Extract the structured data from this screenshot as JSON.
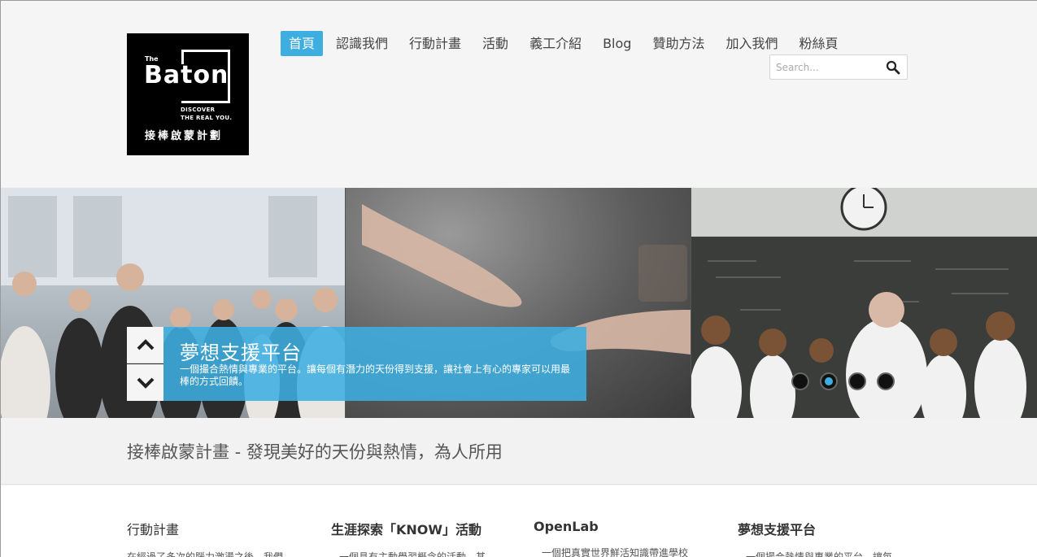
{
  "logo": {
    "the": "The",
    "word": "Baton",
    "sub1": "DISCOVER",
    "sub2": "THE REAL YOU.",
    "zh": "接棒啟蒙計劃"
  },
  "nav": {
    "items": [
      {
        "label": "首頁",
        "active": true
      },
      {
        "label": "認識我們"
      },
      {
        "label": "行動計畫"
      },
      {
        "label": "活動"
      },
      {
        "label": "義工介紹"
      },
      {
        "label": "Blog"
      },
      {
        "label": "贊助方法"
      },
      {
        "label": "加入我們"
      },
      {
        "label": "粉絲頁"
      }
    ]
  },
  "search": {
    "placeholder": "Search..."
  },
  "slider": {
    "caption_title": "夢想支援平台",
    "caption_text": "一個撮合熱情與專業的平台。讓每個有潛力的天份得到支援，讓社會上有心的專家可以用最棒的方式回饋。",
    "dots": 4,
    "active_dot": 2
  },
  "tagline": "接棒啟蒙計畫 - 發現美好的天份與熱情，為人所用",
  "columns": [
    {
      "title": "行動計畫",
      "text": "在經過了多次的腦力激盪之後，我們"
    },
    {
      "title": "生涯探索「KNOW」活動",
      "text": "一個具有主動學習概念的活動。其"
    },
    {
      "title": "OpenLab",
      "text": "一個把真實世界鮮活知識帶進學校"
    },
    {
      "title": "夢想支援平台",
      "text": "一個撮合熱情與專業的平台。讓每"
    }
  ],
  "colors": {
    "accent": "#3eaee0",
    "logo_bg": "#000000"
  }
}
